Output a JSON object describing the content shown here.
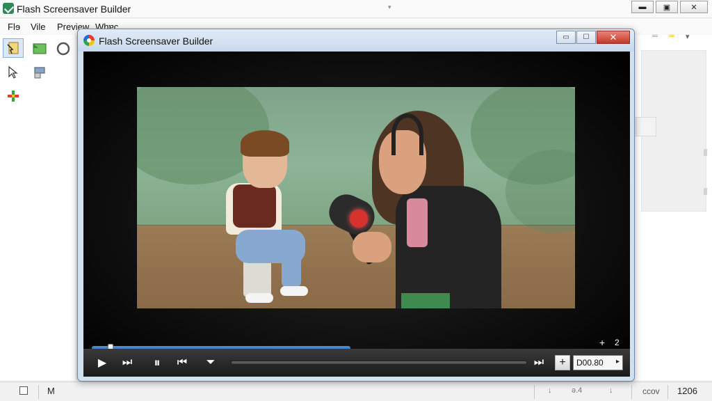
{
  "app": {
    "title": "Flash Screensaver Builder",
    "dropdown_glyph": "▾",
    "window_buttons": {
      "minimize": "▬",
      "maximize": "▣",
      "close": "✕"
    }
  },
  "menu": {
    "file": "Flɘ",
    "edit": "Vile",
    "preview": "Preview",
    "help": "Whɐc"
  },
  "toolbox": {
    "icons": [
      "select-page-icon",
      "green-flag-icon",
      "ring-icon",
      "pointer-icon",
      "layer-icon",
      "color-cross-icon"
    ]
  },
  "right_area": {
    "glyphs": [
      "═",
      "═",
      "▾"
    ]
  },
  "dialog": {
    "title": "Flash Screensaver Builder",
    "buttons": {
      "minimize": "▭",
      "maximize": "☐",
      "close": "✕"
    }
  },
  "player": {
    "seek_progress": 0.49,
    "seek_knob_position": 0.03,
    "overlay_plus": "+",
    "overlay_two": "2",
    "controls": {
      "play": "▶",
      "next": "⏭",
      "pause": "⏸",
      "frame": "⏮",
      "volume": "⏷",
      "end": "⏭"
    },
    "plus_label": "+",
    "time": "D00.80",
    "time_arrow": "▸"
  },
  "status": {
    "m": "M",
    "glyph1": "↓",
    "glyph2": "ǝ.4",
    "glyph3": "↓",
    "ccov": "ccov",
    "number": "1206"
  },
  "colors": {
    "accent": "#1e5f9f",
    "close_red": "#c7382a",
    "dialog_frame": "#cfe0f1"
  }
}
